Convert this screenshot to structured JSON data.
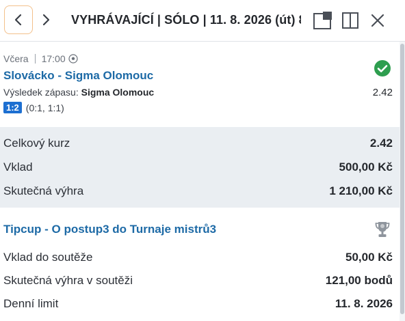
{
  "header": {
    "title": "VYHRÁVAJÍCÍ | SÓLO | 11. 8. 2026 (út) 8..."
  },
  "match": {
    "day": "Včera",
    "time": "17:00",
    "teams": "Slovácko - Sigma Olomouc",
    "result_label": "Výsledek zápasu:",
    "result_value": "Sigma Olomouc",
    "odd": "2.42",
    "score": "1:2",
    "halves": "(0:1, 1:1)",
    "status": "won"
  },
  "summary": [
    {
      "label": "Celkový kurz",
      "value": "2.42"
    },
    {
      "label": "Vklad",
      "value": "500,00 Kč"
    },
    {
      "label": "Skutečná výhra",
      "value": "1 210,00 Kč"
    }
  ],
  "tipcup": {
    "title": "Tipcup - O postup3 do Turnaje mistrů3",
    "rows": [
      {
        "label": "Vklad do soutěže",
        "value": "50,00 Kč"
      },
      {
        "label": "Skutečná výhra v soutěži",
        "value": "121,00 bodů"
      },
      {
        "label": "Denní limit",
        "value": "11. 8. 2026"
      }
    ]
  },
  "colors": {
    "accent": "#1d6aa6",
    "success": "#2e9e4f",
    "summary_bg": "#eaeef2",
    "score_badge": "#1d6fd1"
  }
}
